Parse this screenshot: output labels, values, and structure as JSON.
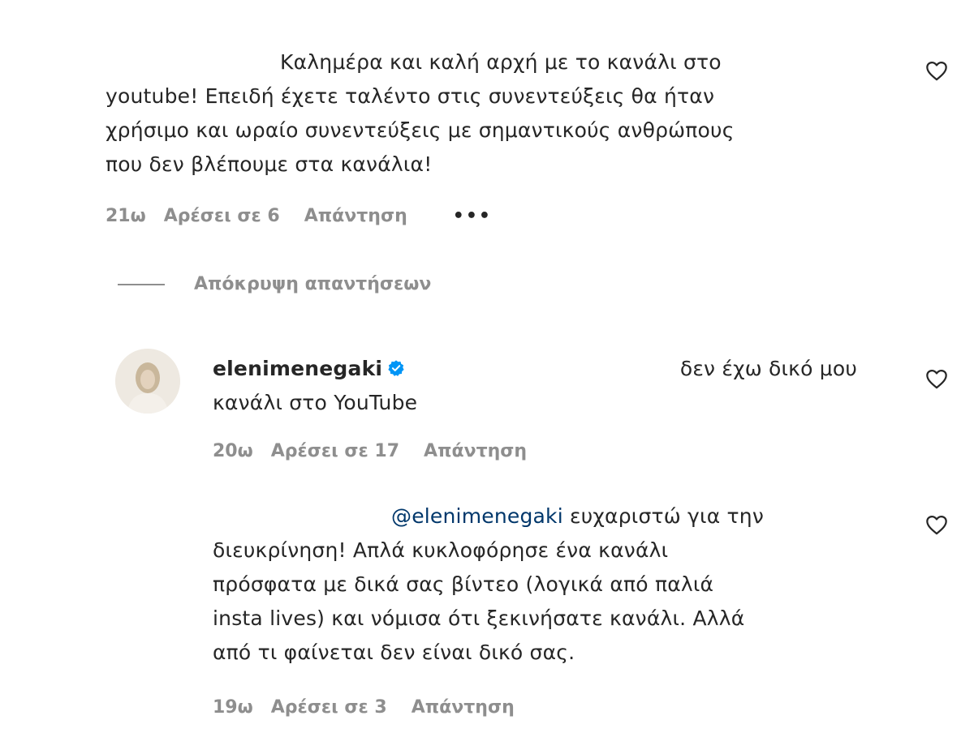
{
  "comments": [
    {
      "lines": [
        "Καλημέρα και καλή αρχή με το κανάλι στο",
        "youtube! Επειδή έχετε ταλέντο στις συνεντεύξεις θα ήταν",
        "χρήσιμο και ωραίο συνεντεύξεις με σημαντικούς ανθρώπους",
        "που δεν βλέπουμε στα κανάλια!"
      ],
      "time": "21ω",
      "likes": "Αρέσει σε 6",
      "reply": "Απάντηση",
      "more": "•••"
    }
  ],
  "hide_replies": "Απόκρυψη απαντήσεων",
  "replies": [
    {
      "username": "elenimenegaki",
      "text_line1": "δεν έχω δικό μου",
      "text_line2": "κανάλι στο YouTube",
      "time": "20ω",
      "likes": "Αρέσει σε 17",
      "reply": "Απάντηση"
    },
    {
      "mention": "@elenimenegaki",
      "text_line1": "ευχαριστώ για την",
      "lines": [
        "διευκρίνηση! Απλά κυκλοφόρησε ένα κανάλι",
        "πρόσφατα με δικά σας βίντεο (λογικά από παλιά",
        "insta lives) και νόμισα ότι ξεκινήσατε κανάλι. Αλλά",
        "από τι φαίνεται δεν είναι δικό σας."
      ],
      "time": "19ω",
      "likes": "Αρέσει σε 3",
      "reply": "Απάντηση"
    }
  ],
  "icons": {
    "heart": "heart-icon",
    "verified": "verified-badge-icon",
    "avatar": "avatar"
  },
  "colors": {
    "text": "#262626",
    "secondary": "#8e8e8e",
    "mention": "#00376b",
    "verified": "#0095f6"
  }
}
